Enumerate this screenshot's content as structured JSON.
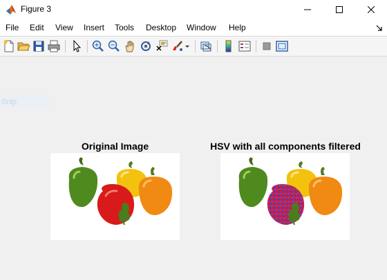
{
  "window": {
    "title": "Figure 3",
    "icons": {
      "app": "matlab-logo-icon",
      "minimize": "minimize-icon",
      "maximize": "maximize-icon",
      "close": "close-icon"
    }
  },
  "menu": {
    "items": [
      "File",
      "Edit",
      "View",
      "Insert",
      "Tools",
      "Desktop",
      "Window",
      "Help"
    ],
    "dock_icon": "dock-arrow-icon"
  },
  "toolbar": {
    "buttons": [
      "new-figure-icon",
      "open-file-icon",
      "save-icon",
      "print-icon",
      "pointer-icon",
      "zoom-in-icon",
      "zoom-out-icon",
      "pan-hand-icon",
      "rotate-3d-icon",
      "data-cursor-icon",
      "brush-icon",
      "brush-dropdown-icon",
      "link-plot-icon",
      "colorbar-icon",
      "legend-icon",
      "hide-plot-tools-icon",
      "show-plot-tools-icon"
    ]
  },
  "figure": {
    "ghost_text": "Snip",
    "axes": [
      {
        "title": "Original Image"
      },
      {
        "title": "HSV with all components filtered"
      }
    ]
  },
  "colors": {
    "green_pepper": "#4f8a1e",
    "yellow_pepper": "#f3c20f",
    "orange_pepper": "#f08a12",
    "red_pepper": "#d91a1a",
    "filtered_noise_blue": "#3b3be0"
  }
}
